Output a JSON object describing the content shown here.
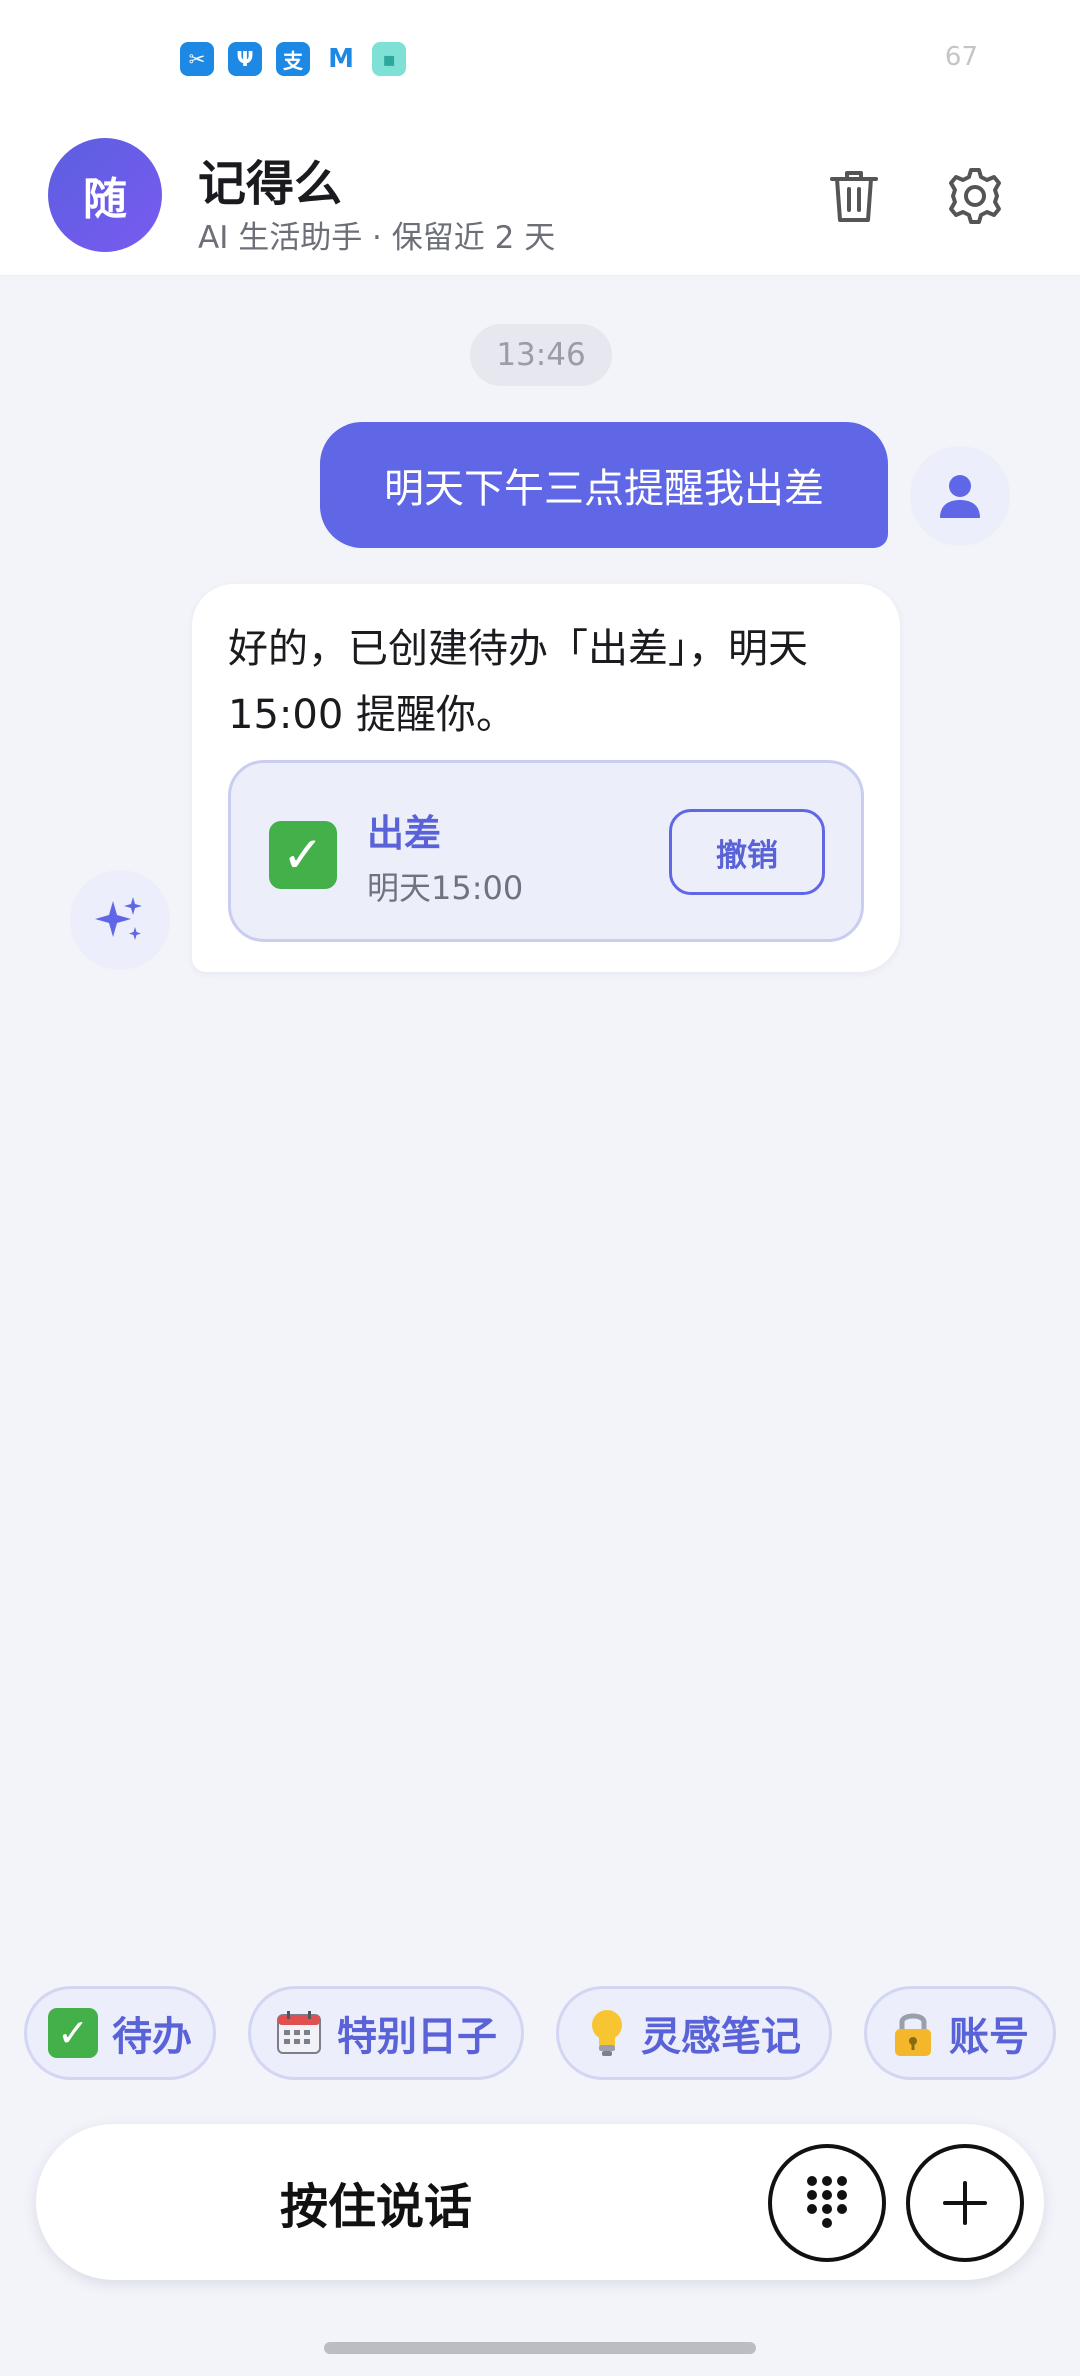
{
  "status_bar": {
    "icons": [
      "scissors-app-icon",
      "usb-icon",
      "alipay-icon",
      "m-app-icon",
      "chat-app-icon"
    ],
    "battery": "67"
  },
  "header": {
    "avatar_text": "随",
    "title": "记得么",
    "subtitle": "AI 生活助手 · 保留近 2 天"
  },
  "chat": {
    "timestamp": "13:46",
    "user_message": "明天下午三点提醒我出差",
    "bot_message": "好的，已创建待办「出差」，明天 15:00 提醒你。",
    "todo_card": {
      "title": "出差",
      "time": "明天15:00",
      "undo_label": "撤销"
    }
  },
  "quick_chips": [
    {
      "icon": "✅",
      "label": "待办"
    },
    {
      "icon": "🗓️",
      "label": "特别日子"
    },
    {
      "icon": "💡",
      "label": "灵感笔记"
    },
    {
      "icon": "🔒",
      "label": "账号"
    }
  ],
  "input_bar": {
    "hold_to_talk": "按住说话"
  },
  "colors": {
    "accent": "#5f67e6",
    "background": "#f3f4fa",
    "check_green": "#43b049"
  }
}
